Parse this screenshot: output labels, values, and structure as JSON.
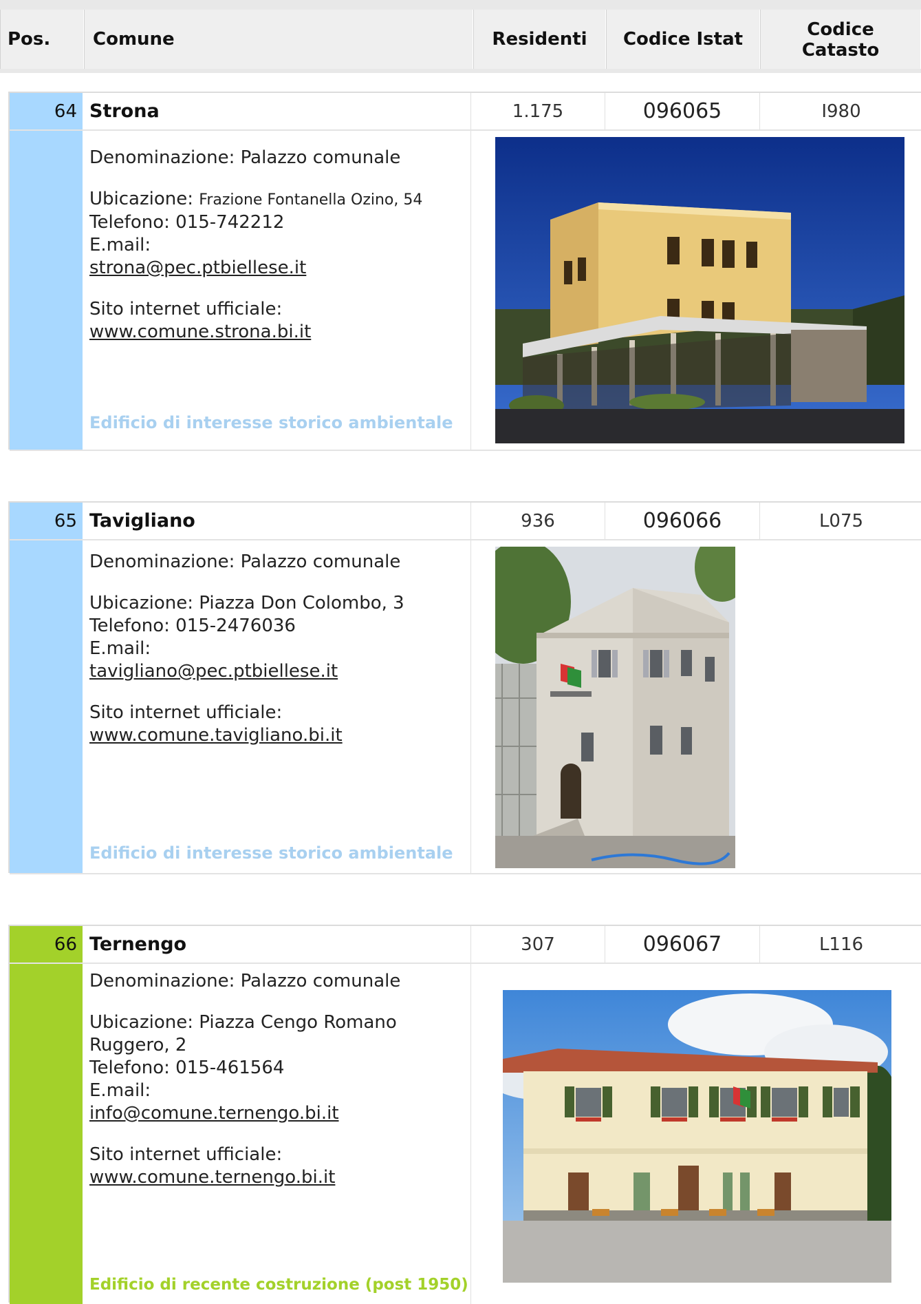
{
  "header": {
    "pos": "Pos.",
    "comune": "Comune",
    "residenti": "Residenti",
    "istat": "Codice Istat",
    "catasto_line1": "Codice",
    "catasto_line2": "Catasto"
  },
  "labels": {
    "denominazione_prefix": "Denominazione: ",
    "ubicazione_prefix": "Ubicazione: ",
    "telefono_prefix": "Telefono: ",
    "email_label": "E.mail:",
    "sito_label": "Sito internet ufficiale:"
  },
  "colors": {
    "storico_sidebar": "#a8d8ff",
    "storico_note": "#a8d0f0",
    "recente_sidebar": "#a3d12a",
    "recente_note": "#a3d12a"
  },
  "records": [
    {
      "pos": "64",
      "name": "Strona",
      "residenti": "1.175",
      "istat": "096065",
      "catasto": "I980",
      "denominazione": "Palazzo comunale",
      "ubicazione": "Frazione Fontanella Ozino, 54",
      "telefono": "015-742212",
      "email": "strona@pec.ptbiellese.it",
      "sito": "www.comune.strona.bi.it",
      "note": "Edificio di interesse storico ambientale",
      "photo": "photo-palazzo-comunale-strona"
    },
    {
      "pos": "65",
      "name": "Tavigliano",
      "residenti": "936",
      "istat": "096066",
      "catasto": "L075",
      "denominazione": "Palazzo comunale",
      "ubicazione": "Piazza Don Colombo, 3",
      "telefono": "015-2476036",
      "email": "tavigliano@pec.ptbiellese.it",
      "sito": "www.comune.tavigliano.bi.it",
      "note": "Edificio di interesse storico ambientale",
      "photo": "photo-palazzo-comunale-tavigliano"
    },
    {
      "pos": "66",
      "name": "Ternengo",
      "residenti": "307",
      "istat": "096067",
      "catasto": "L116",
      "denominazione": "Palazzo comunale",
      "ubicazione_line1": "Piazza Cengo Romano",
      "ubicazione_line2": "Ruggero, 2",
      "telefono": "015-461564",
      "email": "info@comune.ternengo.bi.it",
      "sito": "www.comune.ternengo.bi.it",
      "note": "Edificio di recente costruzione (post 1950)",
      "photo": "photo-palazzo-comunale-ternengo"
    }
  ]
}
